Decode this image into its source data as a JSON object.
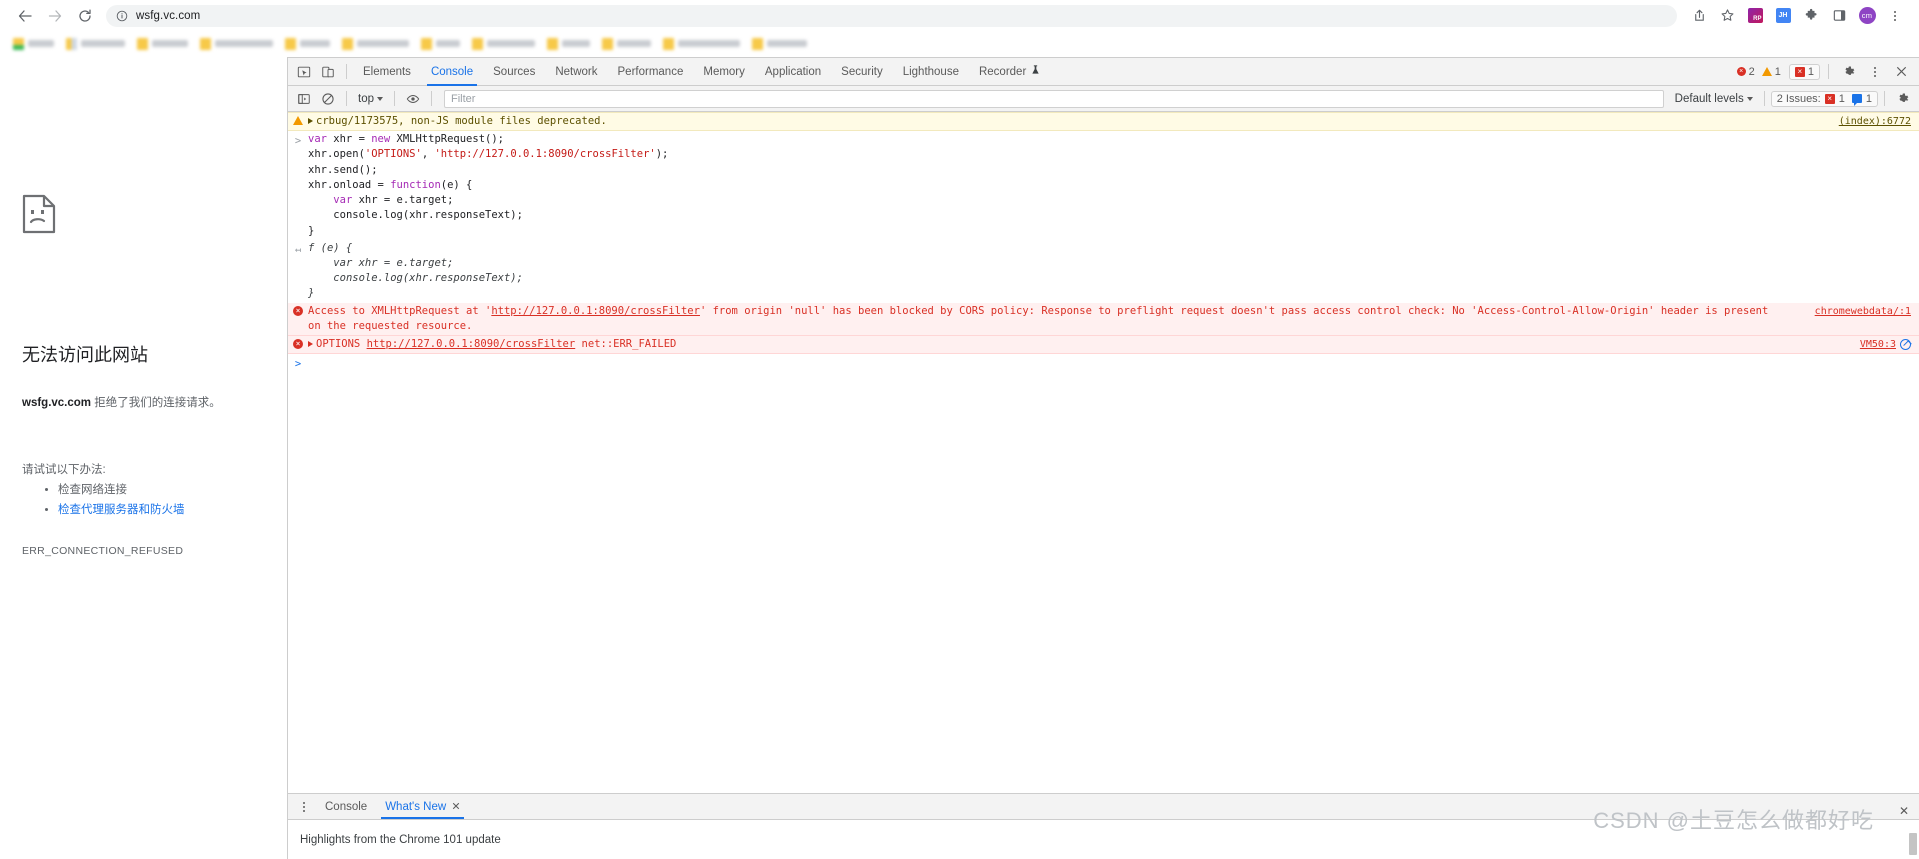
{
  "browser": {
    "url": "wsfg.vc.com",
    "nav": {
      "back": "back-arrow",
      "forward": "forward-arrow",
      "reload": "reload"
    },
    "toolbar_icons": [
      "share-icon",
      "bookmark-star-icon",
      "extension-rp",
      "extension-jh",
      "extensions-puzzle",
      "side-panel",
      "profile-avatar",
      "chrome-menu"
    ],
    "ext_rp_label": "RP",
    "ext_jh_label": "JH",
    "avatar_label": "cm"
  },
  "error_page": {
    "title": "无法访问此网站",
    "body_strong": "wsfg.vc.com",
    "body_rest": " 拒绝了我们的连接请求。",
    "try_label": "请试试以下办法:",
    "suggestions": [
      {
        "text": "检查网络连接",
        "link": false
      },
      {
        "text": "检查代理服务器和防火墙",
        "link": true
      }
    ],
    "code": "ERR_CONNECTION_REFUSED"
  },
  "devtools": {
    "tabs": [
      {
        "label": "Elements",
        "active": false
      },
      {
        "label": "Console",
        "active": true
      },
      {
        "label": "Sources",
        "active": false
      },
      {
        "label": "Network",
        "active": false
      },
      {
        "label": "Performance",
        "active": false
      },
      {
        "label": "Memory",
        "active": false
      },
      {
        "label": "Application",
        "active": false
      },
      {
        "label": "Security",
        "active": false
      },
      {
        "label": "Lighthouse",
        "active": false
      },
      {
        "label": "Recorder",
        "active": false
      }
    ],
    "counts": {
      "errors": "2",
      "warnings": "1",
      "issues": "1"
    },
    "console_toolbar": {
      "context": "top",
      "filter_placeholder": "Filter",
      "levels": "Default levels",
      "issues_label": "2 Issues:",
      "issues_error_count": "1",
      "issues_info_count": "1"
    },
    "messages": [
      {
        "type": "warn",
        "text": "crbug/1173575, non-JS module files deprecated.",
        "source": "(index):6772"
      },
      {
        "type": "input",
        "lines": [
          "var xhr = new XMLHttpRequest();",
          "xhr.open('OPTIONS', 'http://127.0.0.1:8090/crossFilter');",
          "xhr.send();",
          "xhr.onload = function(e) {",
          "    var xhr = e.target;",
          "    console.log(xhr.responseText);",
          "}"
        ],
        "source": ""
      },
      {
        "type": "return",
        "lines": [
          "f (e) {",
          "    var xhr = e.target;",
          "    console.log(xhr.responseText);",
          "}"
        ],
        "source": ""
      },
      {
        "type": "err",
        "text_a": "Access to XMLHttpRequest at '",
        "link": "http://127.0.0.1:8090/crossFilter",
        "text_b": "' from origin 'null' has been blocked by CORS policy: Response to preflight request doesn't pass access control check: No 'Access-Control-Allow-Origin' header is present on the requested resource.",
        "source": "chromewebdata/:1"
      },
      {
        "type": "err",
        "method": "OPTIONS",
        "link": "http://127.0.0.1:8090/crossFilter",
        "text_b": "net::ERR_FAILED",
        "source": "VM50:3"
      }
    ],
    "drawer": {
      "tabs": [
        {
          "label": "Console",
          "active": false,
          "closable": false
        },
        {
          "label": "What's New",
          "active": true,
          "closable": true
        }
      ],
      "content": "Highlights from the Chrome 101 update"
    }
  },
  "watermark": "CSDN @土豆怎么做都好吃"
}
